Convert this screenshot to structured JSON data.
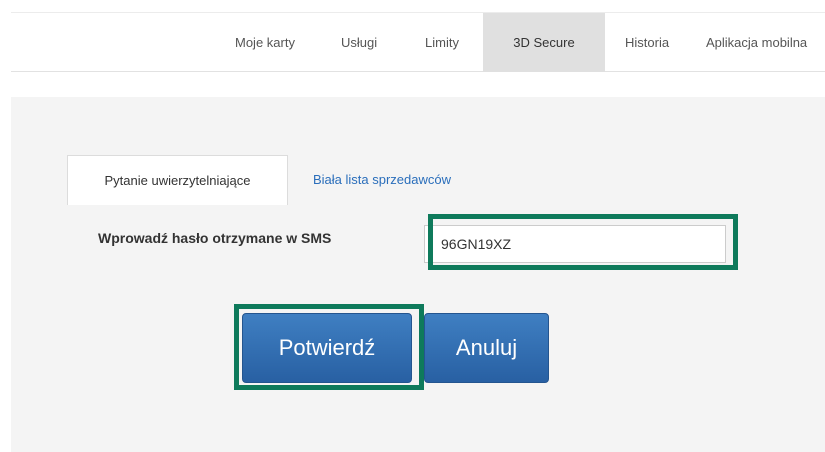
{
  "nav": {
    "items": [
      {
        "label": "Moje karty"
      },
      {
        "label": "Usługi"
      },
      {
        "label": "Limity"
      },
      {
        "label": "3D Secure"
      },
      {
        "label": "Historia"
      },
      {
        "label": "Aplikacja mobilna"
      }
    ],
    "active": "3D Secure"
  },
  "tabs": [
    {
      "label": "Pytanie uwierzytelniające"
    },
    {
      "label": "Biała lista sprzedawców"
    }
  ],
  "form": {
    "sms_label": "Wprowadź hasło otrzymane w SMS",
    "sms_value": "96GN19XZ",
    "confirm_label": "Potwierdź",
    "cancel_label": "Anuluj"
  },
  "colors": {
    "highlight": "#0e7a5b",
    "button": "#2f6fb4",
    "link": "#2a6ebb"
  }
}
